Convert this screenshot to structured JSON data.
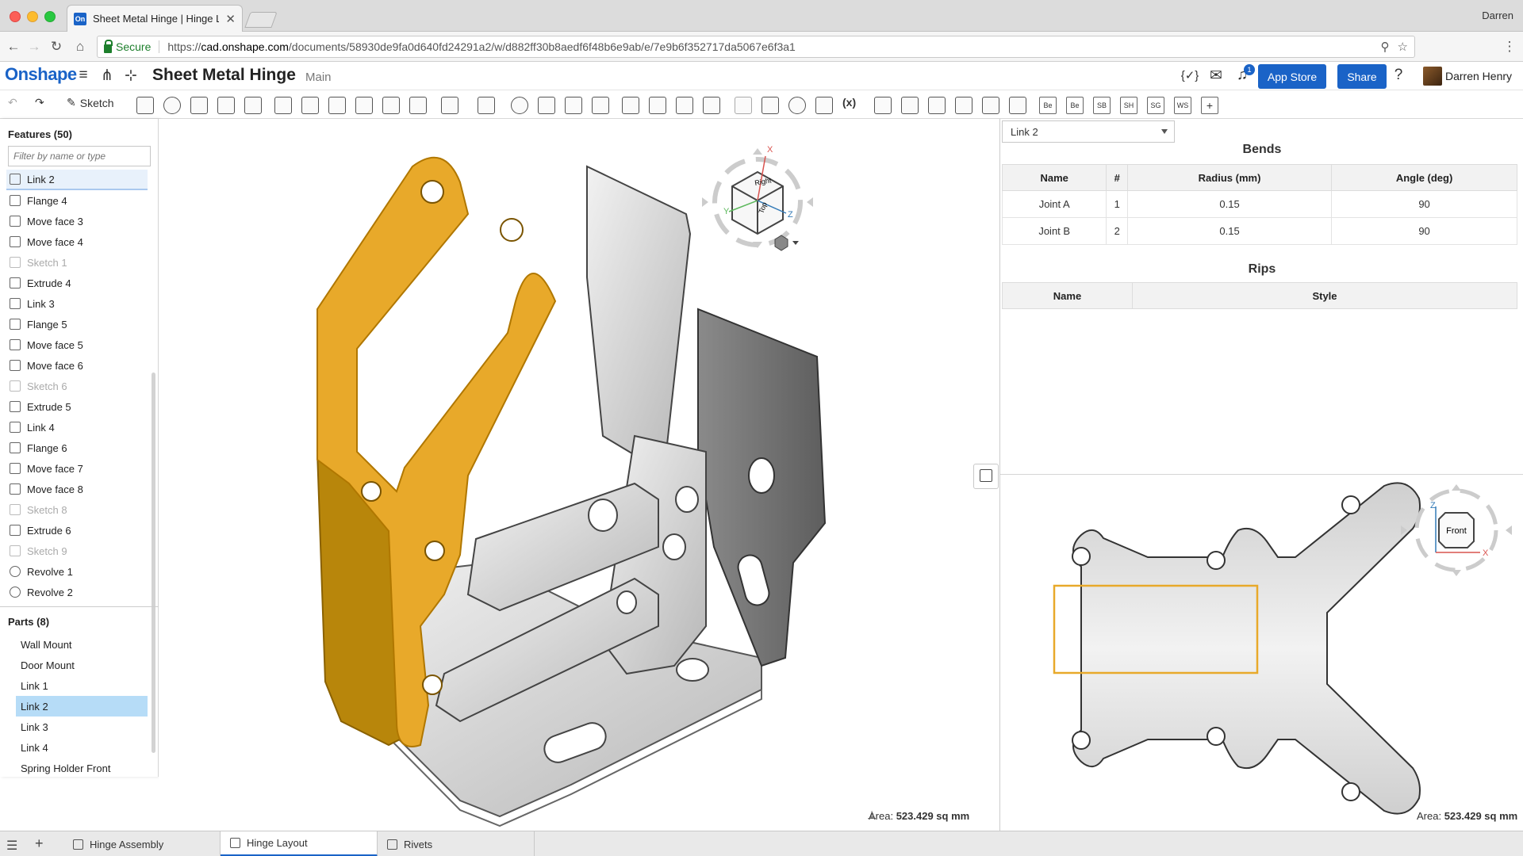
{
  "browser": {
    "tab_title": "Sheet Metal Hinge | Hinge Layout",
    "user": "Darren",
    "secure_label": "Secure",
    "url_scheme": "https://",
    "url_host": "cad.onshape.com",
    "url_path": "/documents/58930de9fa0d640fd24291a2/w/d882ff30b8aedf6f48b6e9ab/e/7e9b6f352717da5067e6f3a1"
  },
  "app": {
    "logo": "Onshape",
    "document_title": "Sheet Metal Hinge",
    "branch": "Main",
    "notification_count": "1",
    "app_store_label": "App Store",
    "share_label": "Share",
    "user_name": "Darren Henry"
  },
  "toolbar": {
    "sketch_label": "Sketch",
    "variable_label": "(x)",
    "custom_labels": [
      "Be",
      "Be",
      "SB",
      "SH",
      "SG",
      "WS"
    ]
  },
  "features": {
    "heading": "Features (50)",
    "filter_placeholder": "Filter by name or type",
    "items": [
      {
        "label": "Link 2",
        "icon": "link-icon",
        "state": "selected"
      },
      {
        "label": "Flange 4",
        "icon": "flange-icon",
        "state": "normal"
      },
      {
        "label": "Move face 3",
        "icon": "move-face-icon",
        "state": "normal"
      },
      {
        "label": "Move face 4",
        "icon": "move-face-icon",
        "state": "normal"
      },
      {
        "label": "Sketch 1",
        "icon": "sketch-icon",
        "state": "dim"
      },
      {
        "label": "Extrude 4",
        "icon": "extrude-icon",
        "state": "normal"
      },
      {
        "label": "Link 3",
        "icon": "link-icon",
        "state": "normal"
      },
      {
        "label": "Flange 5",
        "icon": "flange-icon",
        "state": "normal"
      },
      {
        "label": "Move face 5",
        "icon": "move-face-icon",
        "state": "normal"
      },
      {
        "label": "Move face 6",
        "icon": "move-face-icon",
        "state": "normal"
      },
      {
        "label": "Sketch 6",
        "icon": "sketch-icon",
        "state": "dim"
      },
      {
        "label": "Extrude 5",
        "icon": "extrude-icon",
        "state": "normal"
      },
      {
        "label": "Link 4",
        "icon": "link-icon",
        "state": "normal"
      },
      {
        "label": "Flange 6",
        "icon": "flange-icon",
        "state": "normal"
      },
      {
        "label": "Move face 7",
        "icon": "move-face-icon",
        "state": "normal"
      },
      {
        "label": "Move face 8",
        "icon": "move-face-icon",
        "state": "normal"
      },
      {
        "label": "Sketch 8",
        "icon": "sketch-icon",
        "state": "dim"
      },
      {
        "label": "Extrude 6",
        "icon": "extrude-icon",
        "state": "normal"
      },
      {
        "label": "Sketch 9",
        "icon": "sketch-icon",
        "state": "dim"
      },
      {
        "label": "Revolve 1",
        "icon": "revolve-icon",
        "state": "normal"
      },
      {
        "label": "Revolve 2",
        "icon": "revolve-icon",
        "state": "normal"
      }
    ]
  },
  "parts": {
    "heading": "Parts (8)",
    "items": [
      {
        "label": "Wall Mount",
        "state": "normal"
      },
      {
        "label": "Door Mount",
        "state": "normal"
      },
      {
        "label": "Link 1",
        "state": "normal"
      },
      {
        "label": "Link 2",
        "state": "selected"
      },
      {
        "label": "Link 3",
        "state": "normal"
      },
      {
        "label": "Link 4",
        "state": "normal"
      },
      {
        "label": "Spring Holder Front",
        "state": "normal"
      }
    ]
  },
  "viewport": {
    "area_label": "Area:",
    "area_value": "523.429 sq mm",
    "view_cube_faces": [
      "Right",
      "Top",
      "Front"
    ],
    "axis_labels": [
      "X",
      "Y",
      "Z"
    ]
  },
  "flat_pattern": {
    "selected_part": "Link 2",
    "bends_title": "Bends",
    "bends_columns": [
      "Name",
      "#",
      "Radius (mm)",
      "Angle (deg)"
    ],
    "bends_rows": [
      [
        "Joint A",
        "1",
        "0.15",
        "90"
      ],
      [
        "Joint B",
        "2",
        "0.15",
        "90"
      ]
    ],
    "rips_title": "Rips",
    "rips_columns": [
      "Name",
      "Style"
    ],
    "view_face": "Front",
    "area_label": "Area:",
    "area_value": "523.429 sq mm"
  },
  "bottom_tabs": [
    {
      "label": "Hinge Assembly",
      "active": false
    },
    {
      "label": "Hinge Layout",
      "active": true
    },
    {
      "label": "Rivets",
      "active": false
    }
  ],
  "colors": {
    "accent": "#1a63c7",
    "selection_orange": "#e8a92a",
    "selected_row": "#b6dcf7"
  }
}
